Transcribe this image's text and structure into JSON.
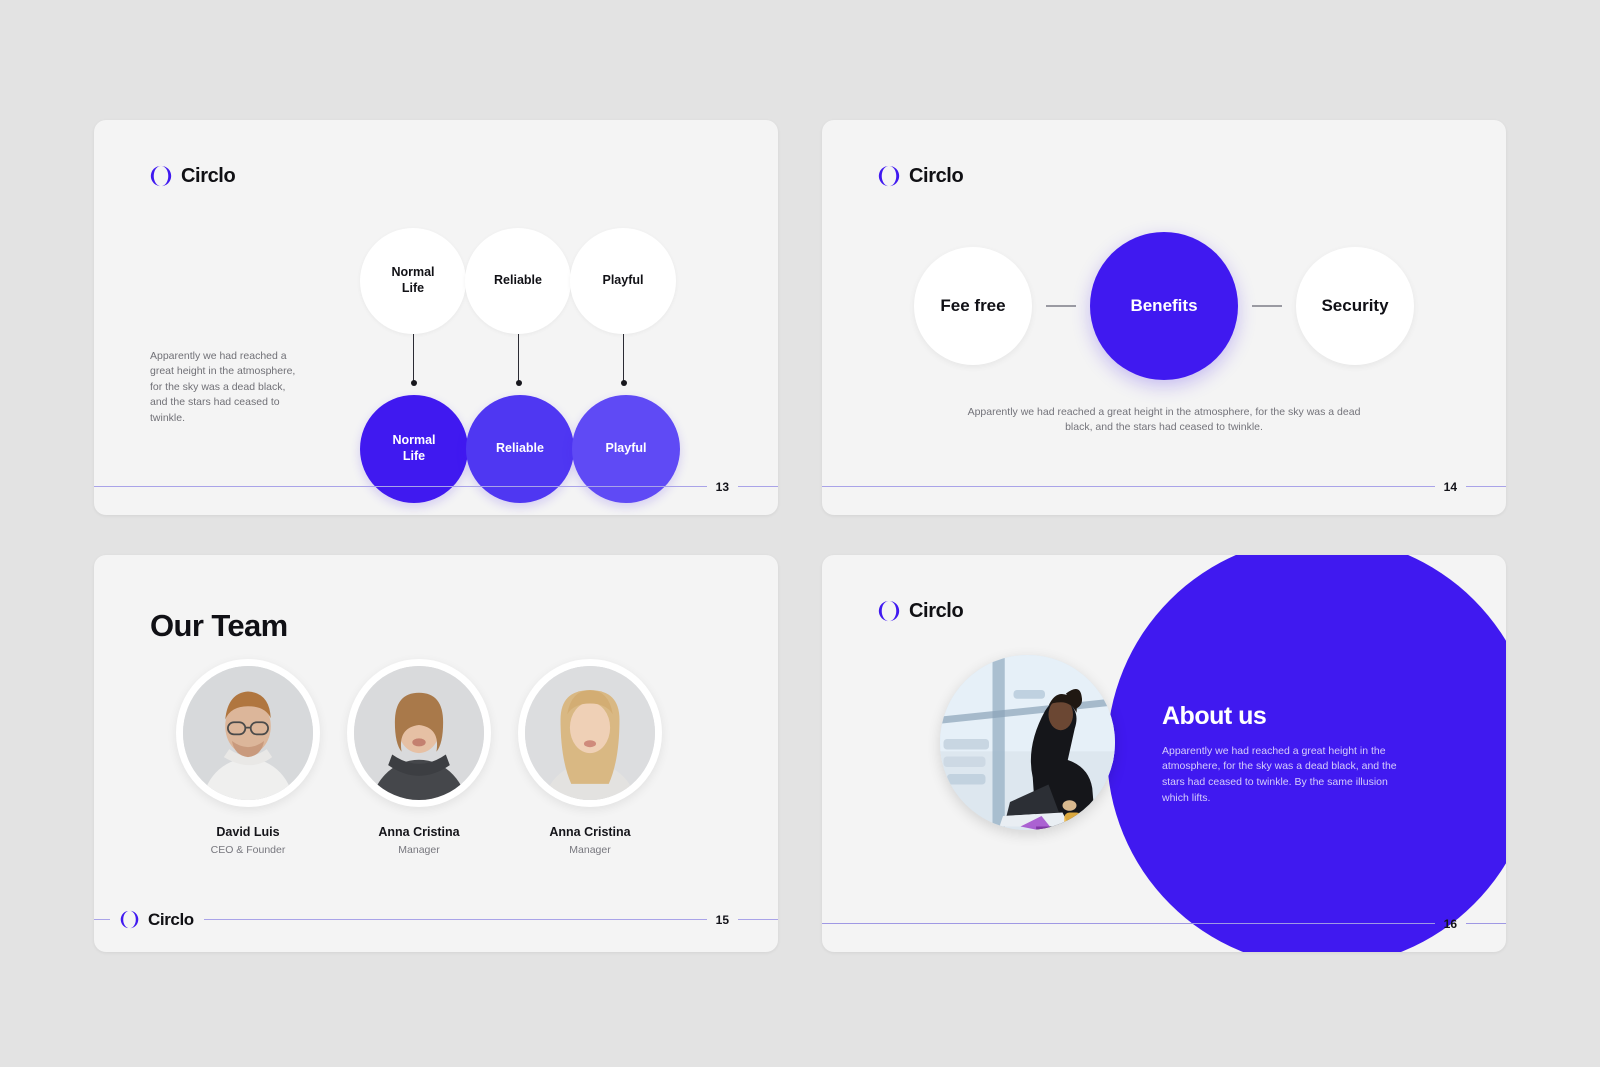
{
  "brand": {
    "name": "Circlo",
    "logo_icon": "circlo-split-circle-icon",
    "accent": "#4019f0",
    "accent_mid": "#4f37f2",
    "accent_light": "#5f4af5",
    "footer_rule_color": "#a9a3e8",
    "slide_bg": "#f4f4f4",
    "page_bg": "#e3e3e3"
  },
  "slides": [
    {
      "id": "slide-13",
      "page_number": "13",
      "logo_text": "Circlo",
      "paragraph": "Apparently  we had reached a great height in the atmosphere, for the sky was a dead black, and the stars had ceased to twinkle.",
      "top_bubbles": [
        {
          "label": "Normal Life",
          "line1": "Normal",
          "line2": "Life"
        },
        {
          "label": "Reliable",
          "line1": "Reliable",
          "line2": ""
        },
        {
          "label": "Playful",
          "line1": "Playful",
          "line2": ""
        }
      ],
      "bottom_bubbles": [
        {
          "label": "Normal Life",
          "line1": "Normal",
          "line2": "Life",
          "color": "#4019f0"
        },
        {
          "label": "Reliable",
          "line1": "Reliable",
          "line2": "",
          "color": "#4f37f2"
        },
        {
          "label": "Playful",
          "line1": "Playful",
          "line2": "",
          "color": "#5f4af5"
        }
      ]
    },
    {
      "id": "slide-14",
      "page_number": "14",
      "logo_text": "Circlo",
      "nodes": [
        {
          "label": "Fee free",
          "style": "plain"
        },
        {
          "label": "Benefits",
          "style": "accent",
          "color": "#4019f0"
        },
        {
          "label": "Security",
          "style": "plain"
        }
      ],
      "paragraph": "Apparently  we had reached a great height in the atmosphere, for the sky was a dead black, and the stars had ceased to twinkle."
    },
    {
      "id": "slide-15",
      "page_number": "15",
      "logo_text": "Circlo",
      "title": "Our Team",
      "members": [
        {
          "name": "David Luis",
          "role": "CEO & Founder",
          "photo": "portrait-man-glasses-beard-white-tshirt"
        },
        {
          "name": "Anna Cristina",
          "role": "Manager",
          "photo": "portrait-woman-short-blonde-hair-grey-top"
        },
        {
          "name": "Anna Cristina",
          "role": "Manager",
          "photo": "portrait-woman-long-blonde-hair-light-sweater"
        }
      ]
    },
    {
      "id": "slide-16",
      "page_number": "16",
      "logo_text": "Circlo",
      "title": "About us",
      "paragraph": "Apparently  we had reached a great height in the atmosphere, for the sky was a dead black, and the stars had ceased to twinkle. By the same illusion which lifts.",
      "photo": "woman-working-on-laptop-by-window",
      "blob_color": "#4019f0"
    }
  ]
}
